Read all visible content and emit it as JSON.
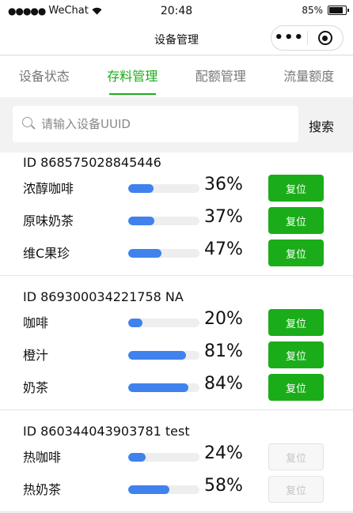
{
  "status_bar": {
    "signal": "●●●●●",
    "carrier": "WeChat",
    "time": "20:48",
    "battery": "85%",
    "battery_level": 0.85
  },
  "nav": {
    "title": "设备管理",
    "more": "•••"
  },
  "tabs": [
    "设备状态",
    "存料管理",
    "配额管理",
    "流量额度"
  ],
  "active_tab": 1,
  "search": {
    "placeholder": "请输入设备UUID",
    "button": "搜索"
  },
  "reset_label": "复位",
  "devices": [
    {
      "id": "ID 868575028845446",
      "items": [
        {
          "name": "浓醇咖啡",
          "percent": 36,
          "percent_text": "36%",
          "enabled": true
        },
        {
          "name": "原味奶茶",
          "percent": 37,
          "percent_text": "37%",
          "enabled": true
        },
        {
          "name": "维C果珍",
          "percent": 47,
          "percent_text": "47%",
          "enabled": true
        }
      ]
    },
    {
      "id": "ID 869300034221758 NA",
      "items": [
        {
          "name": "咖啡",
          "percent": 20,
          "percent_text": "20%",
          "enabled": true
        },
        {
          "name": "橙汁",
          "percent": 81,
          "percent_text": "81%",
          "enabled": true
        },
        {
          "name": "奶茶",
          "percent": 84,
          "percent_text": "84%",
          "enabled": true
        }
      ]
    },
    {
      "id": "ID 860344043903781 test",
      "items": [
        {
          "name": "热咖啡",
          "percent": 24,
          "percent_text": "24%",
          "enabled": false
        },
        {
          "name": "热奶茶",
          "percent": 58,
          "percent_text": "58%",
          "enabled": false
        }
      ]
    }
  ]
}
